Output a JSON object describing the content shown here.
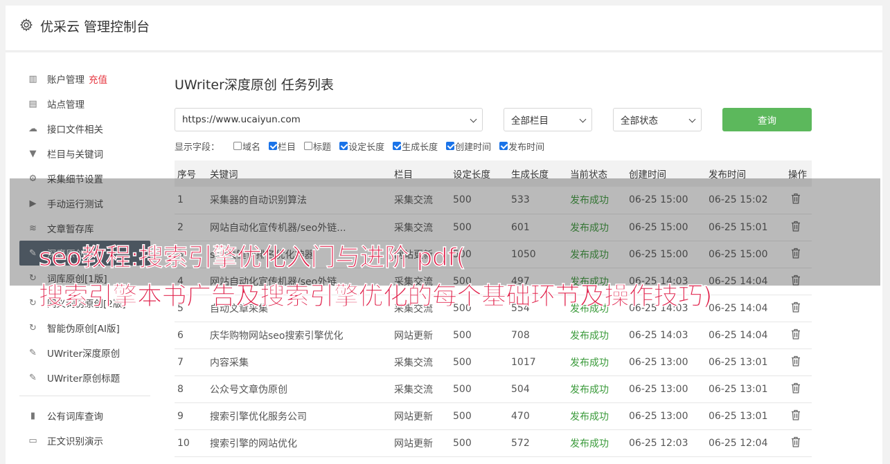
{
  "header": {
    "title": "优采云 管理控制台",
    "icon": "gear-icon"
  },
  "sidebar": {
    "items": [
      {
        "label": "账户管理",
        "extra": "充值",
        "icon": "bar-chart-icon"
      },
      {
        "label": "站点管理",
        "icon": "server-icon"
      },
      {
        "label": "接口文件相关",
        "icon": "cloud-upload-icon"
      },
      {
        "label": "栏目与关键词",
        "icon": "filter-icon"
      },
      {
        "label": "采集细节设置",
        "icon": "gears-icon"
      },
      {
        "label": "手动运行测试",
        "icon": "play-icon"
      },
      {
        "label": "文章暂存库",
        "icon": "database-icon"
      },
      {
        "label": "深度原创",
        "icon": "edit-icon"
      },
      {
        "label": "词库原创[1版]",
        "icon": "refresh-icon"
      },
      {
        "label": "同义词伪原创[2版]",
        "icon": "refresh-icon"
      },
      {
        "label": "智能伪原创[AI版]",
        "icon": "refresh-icon"
      },
      {
        "label": "UWriter深度原创",
        "icon": "edit-icon"
      },
      {
        "label": "UWriter原创标题",
        "icon": "edit-icon"
      },
      {
        "label": "公有词库查询",
        "icon": "book-icon"
      },
      {
        "label": "正文识别演示",
        "icon": "monitor-icon"
      }
    ]
  },
  "main": {
    "title": "UWriter深度原创 任务列表",
    "site_select": "https://www.ucaiyun.com",
    "column_select": "全部栏目",
    "status_select": "全部状态",
    "query_button": "查询",
    "fields_label": "显示字段：",
    "fields": [
      {
        "label": "域名",
        "checked": false
      },
      {
        "label": "栏目",
        "checked": true
      },
      {
        "label": "标题",
        "checked": false
      },
      {
        "label": "设定长度",
        "checked": true
      },
      {
        "label": "生成长度",
        "checked": true
      },
      {
        "label": "创建时间",
        "checked": true
      },
      {
        "label": "发布时间",
        "checked": true
      }
    ],
    "columns": [
      "序号",
      "关键词",
      "栏目",
      "设定长度",
      "生成长度",
      "当前状态",
      "创建时间",
      "发布时间",
      "操作"
    ],
    "rows": [
      [
        "1",
        "采集器的自动识别算法",
        "采集交流",
        "500",
        "533",
        "发布成功",
        "06-25 15:00",
        "06-25 15:02"
      ],
      [
        "2",
        "网站自动化宣传机器/seo外链...",
        "采集交流",
        "500",
        "601",
        "发布成功",
        "06-25 15:00",
        "06-25 15:01"
      ],
      [
        "3",
        "seo关键词排名优化神器",
        "网站更新",
        "500",
        "1050",
        "发布成功",
        "06-25 15:00",
        "06-25 15:00"
      ],
      [
        "4",
        "网站自动化宣传机器/seo外链",
        "采集交流",
        "500",
        "497",
        "发布成功",
        "06-25 14:03",
        "06-25 14:04"
      ],
      [
        "5",
        "自动文章采集",
        "采集交流",
        "500",
        "554",
        "发布成功",
        "06-25 14:03",
        "06-25 14:04"
      ],
      [
        "6",
        "庆华购物网站seo搜索引擎优化",
        "网站更新",
        "500",
        "708",
        "发布成功",
        "06-25 14:03",
        "06-25 14:04"
      ],
      [
        "7",
        "内容采集",
        "采集交流",
        "500",
        "1017",
        "发布成功",
        "06-25 13:00",
        "06-25 13:01"
      ],
      [
        "8",
        "公众号文章伪原创",
        "采集交流",
        "500",
        "504",
        "发布成功",
        "06-25 13:00",
        "06-25 13:01"
      ],
      [
        "9",
        "搜索引擎优化服务公司",
        "网站更新",
        "500",
        "470",
        "发布成功",
        "06-25 13:00",
        "06-25 13:01"
      ],
      [
        "10",
        "搜索引擎的网站优化",
        "网站更新",
        "500",
        "572",
        "发布成功",
        "06-25 12:03",
        "06-25 12:04"
      ]
    ]
  },
  "overlay": {
    "line1": "seo教程:搜索引擎优化入门与进阶 pdf(",
    "line2": "搜索引擎本书广告及搜索引擎优化的每个基础环节及操作技巧)"
  },
  "colors": {
    "accent": "#5cb85c",
    "success": "#3a9a3a",
    "recharge": "#e6363f",
    "overlay_text": "#e0204a"
  }
}
